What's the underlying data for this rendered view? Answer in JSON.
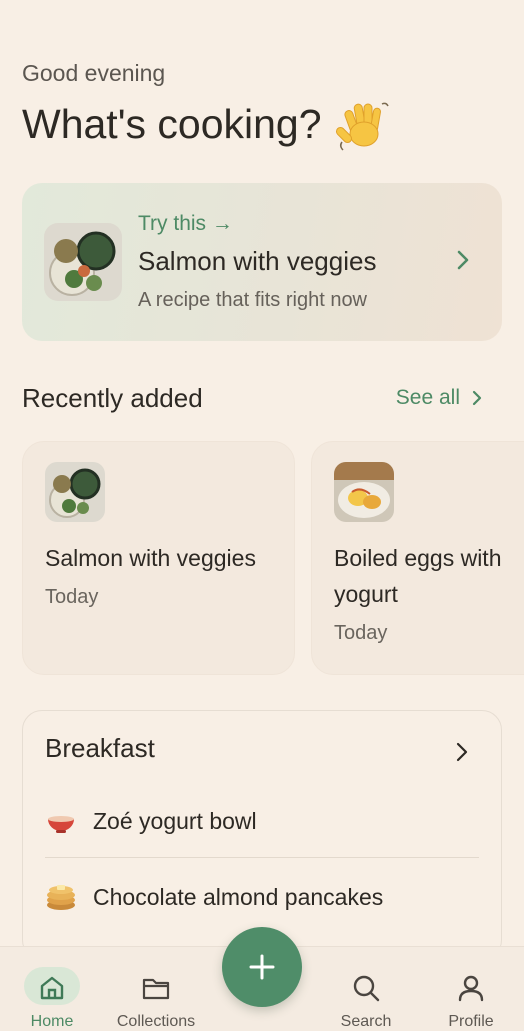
{
  "header": {
    "greeting": "Good evening",
    "headline": "What's cooking?"
  },
  "featured": {
    "eyebrow": "Try this →",
    "title": "Salmon with veggies",
    "subtitle": "A recipe that fits right now"
  },
  "recent": {
    "section_title": "Recently added",
    "see_all_label": "See all",
    "items": [
      {
        "name": "Salmon with veggies",
        "date": "Today"
      },
      {
        "name": "Boiled eggs with yogurt",
        "date": "Today"
      }
    ]
  },
  "collection": {
    "title": "Breakfast",
    "items": [
      {
        "emoji": "bowl-icon",
        "label": "Zoé yogurt bowl"
      },
      {
        "emoji": "pancakes-icon",
        "label": "Chocolate almond pancakes"
      }
    ]
  },
  "nav": {
    "items": [
      {
        "label": "Home",
        "icon": "home-icon",
        "active": true
      },
      {
        "label": "Collections",
        "icon": "folder-icon"
      },
      {
        "label": "Search",
        "icon": "search-icon"
      },
      {
        "label": "Profile",
        "icon": "profile-icon"
      }
    ],
    "fab_icon": "plus-icon"
  },
  "colors": {
    "accent": "#4d8a65",
    "background": "#f8efe5",
    "fab": "#4f8d69"
  }
}
